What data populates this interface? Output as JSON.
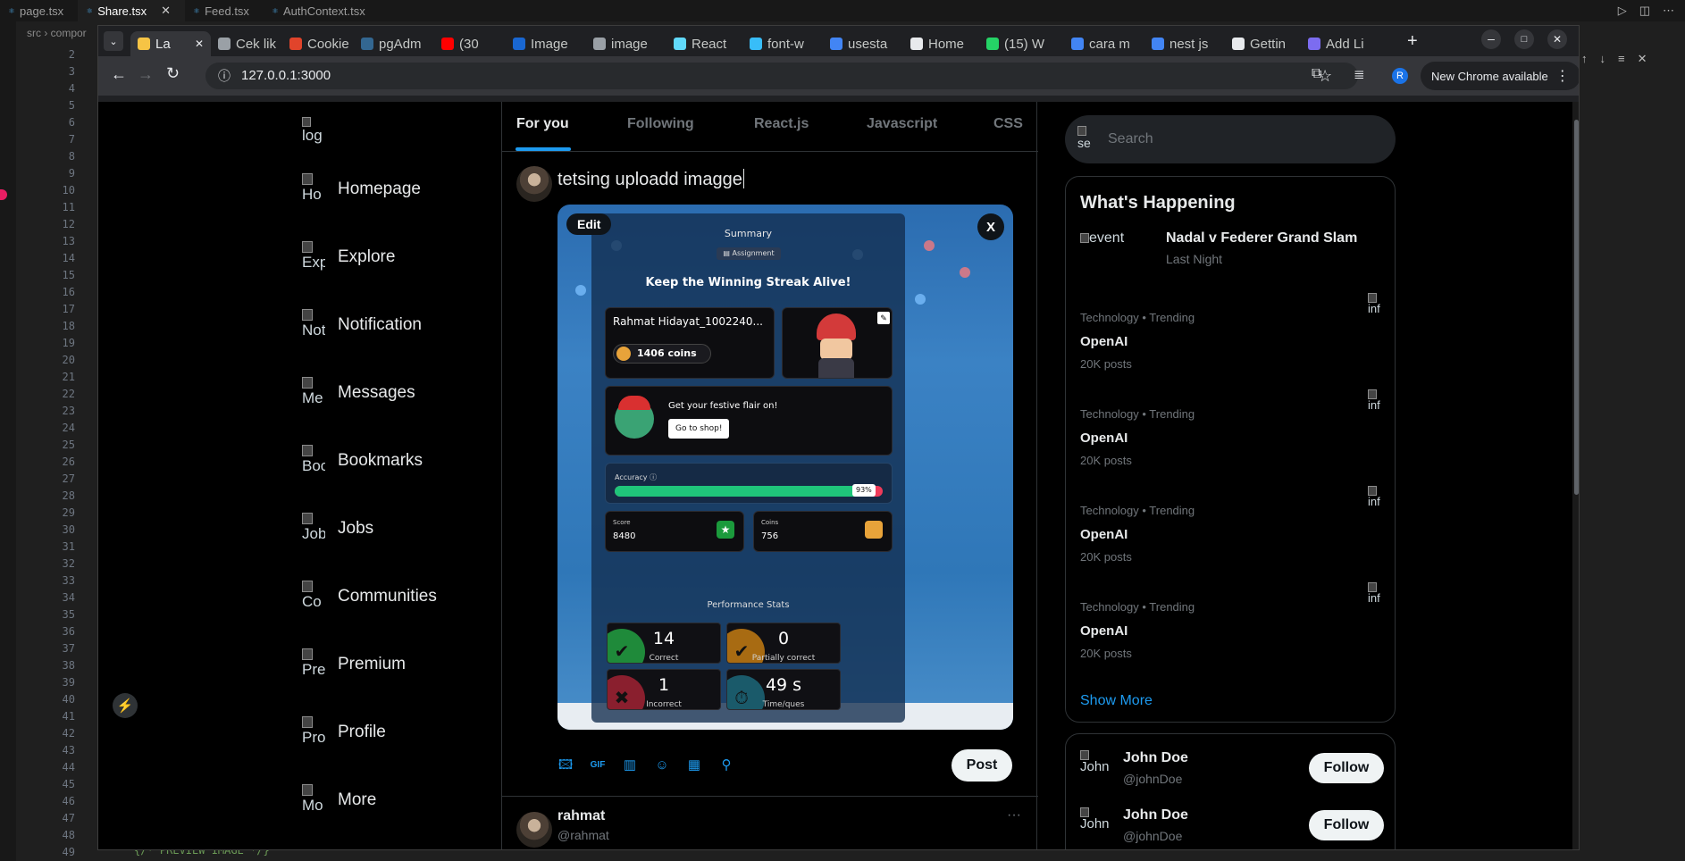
{
  "vscode": {
    "tabs": [
      {
        "label": "page.tsx",
        "active": false
      },
      {
        "label": "Share.tsx",
        "active": true
      },
      {
        "label": "Feed.tsx",
        "active": false
      },
      {
        "label": "AuthContext.tsx",
        "active": false
      }
    ],
    "breadcrumb": "src › compor",
    "line_numbers": [
      "2",
      "3",
      "4",
      "5",
      "6",
      "7",
      "8",
      "9",
      "10",
      "11",
      "12",
      "13",
      "14",
      "15",
      "16",
      "17",
      "18",
      "19",
      "20",
      "21",
      "22",
      "23",
      "24",
      "25",
      "26",
      "27",
      "28",
      "29",
      "30",
      "31",
      "32",
      "33",
      "34",
      "35",
      "36",
      "37",
      "38",
      "39",
      "40",
      "41",
      "42",
      "43",
      "44",
      "45",
      "46",
      "47",
      "48",
      "49"
    ],
    "bottom_code": "{/* PREVIEW IMAGE */}"
  },
  "chrome": {
    "tabs": [
      {
        "label": "La",
        "active": true,
        "color": "#f6c445"
      },
      {
        "label": "Cek lik",
        "color": "#9aa0a6"
      },
      {
        "label": "Cookie",
        "color": "#e1442b"
      },
      {
        "label": "pgAdm",
        "color": "#336791"
      },
      {
        "label": "(30",
        "color": "#ff0000"
      },
      {
        "label": "Image",
        "color": "#1967d2"
      },
      {
        "label": "image",
        "color": "#9aa0a6"
      },
      {
        "label": "React",
        "color": "#61dafb"
      },
      {
        "label": "font-w",
        "color": "#38bdf8"
      },
      {
        "label": "usesta",
        "color": "#4285f4"
      },
      {
        "label": "Home",
        "color": "#e8eaed"
      },
      {
        "label": "(15) W",
        "color": "#25d366"
      },
      {
        "label": "cara m",
        "color": "#4285f4"
      },
      {
        "label": "nest js",
        "color": "#4285f4"
      },
      {
        "label": "Gettin",
        "color": "#e8eaed"
      },
      {
        "label": "Add Li",
        "color": "#7c6cf0"
      }
    ],
    "url": "127.0.0.1:3000",
    "update_label": "New Chrome available",
    "profile_initial": "R"
  },
  "sidebar": {
    "logo_alt": "log",
    "items": [
      {
        "alt": "Ho",
        "label": "Homepage"
      },
      {
        "alt": "Exp",
        "label": "Explore"
      },
      {
        "alt": "Not",
        "label": "Notification"
      },
      {
        "alt": "Me",
        "label": "Messages"
      },
      {
        "alt": "Boc",
        "label": "Bookmarks"
      },
      {
        "alt": "Job",
        "label": "Jobs"
      },
      {
        "alt": "Co",
        "label": "Communities"
      },
      {
        "alt": "Pre",
        "label": "Premium"
      },
      {
        "alt": "Pro",
        "label": "Profile"
      },
      {
        "alt": "Mo",
        "label": "More"
      }
    ]
  },
  "feed_tabs": [
    "For you",
    "Following",
    "React.js",
    "Javascript",
    "CSS"
  ],
  "compose": {
    "text": "tetsing uploadd imagge",
    "edit_label": "Edit",
    "close_label": "X",
    "post_label": "Post"
  },
  "preview_image": {
    "summary": "Summary",
    "assignment": "Assignment",
    "headline": "Keep the Winning Streak Alive!",
    "player": "Rahmat Hidayat_1002240...",
    "coins_badge": "1406 coins",
    "festive": "Get your festive flair on!",
    "shop_button": "Go to shop!",
    "accuracy_label": "Accuracy",
    "accuracy_pct": "93%",
    "accuracy_value": 0.93,
    "score_label": "Score",
    "score_value": "8480",
    "coins_label": "Coins",
    "coins_value": "756",
    "perf_title": "Performance Stats",
    "stats": [
      {
        "num": "14",
        "label": "Correct",
        "color": "#1f8a3a"
      },
      {
        "num": "0",
        "label": "Partially correct",
        "color": "#a86b12"
      },
      {
        "num": "1",
        "label": "Incorrect",
        "color": "#8a1f2e"
      },
      {
        "num": "49 s",
        "label": "Time/ques",
        "color": "#1a5a6a"
      }
    ]
  },
  "tweet": {
    "name": "rahmat",
    "handle": "@rahmat",
    "more": "···"
  },
  "right": {
    "search_placeholder": "Search",
    "search_alt": "se",
    "happening_title": "What's Happening",
    "event_alt": "event",
    "event_title": "Nadal v Federer Grand Slam",
    "event_time": "Last Night",
    "trends": [
      {
        "meta": "Technology • Trending",
        "name": "OpenAI",
        "posts": "20K posts",
        "alt": "inf"
      },
      {
        "meta": "Technology • Trending",
        "name": "OpenAI",
        "posts": "20K posts",
        "alt": "inf"
      },
      {
        "meta": "Technology • Trending",
        "name": "OpenAI",
        "posts": "20K posts",
        "alt": "inf"
      },
      {
        "meta": "Technology • Trending",
        "name": "OpenAI",
        "posts": "20K posts",
        "alt": "inf"
      }
    ],
    "show_more": "Show More",
    "follows": [
      {
        "alt": "John",
        "name": "John Doe",
        "handle": "@johnDoe",
        "button": "Follow"
      },
      {
        "alt": "John",
        "name": "John Doe",
        "handle": "@johnDoe",
        "button": "Follow"
      }
    ]
  }
}
